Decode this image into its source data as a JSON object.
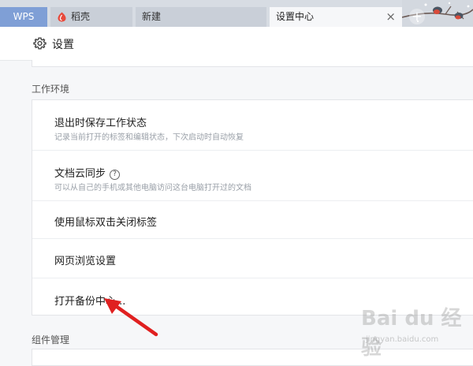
{
  "tabs": [
    {
      "label": "WPS"
    },
    {
      "label": "稻壳"
    },
    {
      "label": "新建"
    },
    {
      "label": "设置中心",
      "close": "×"
    }
  ],
  "add_tab": "+",
  "header": {
    "title": "设置"
  },
  "sections": {
    "work_env": "工作环境",
    "components": "组件管理"
  },
  "settings_rows": [
    {
      "title": "退出时保存工作状态",
      "desc": "记录当前打开的标签和编辑状态，下次启动时自动恢复"
    },
    {
      "title": "文档云同步",
      "desc": "可以从自己的手机或其他电脑访问这台电脑打开过的文档",
      "help": "?"
    },
    {
      "title": "使用鼠标双击关闭标签"
    },
    {
      "title": "网页浏览设置"
    },
    {
      "title": "打开备份中心..."
    }
  ],
  "watermark": {
    "brand": "Bai du 经验",
    "url": "jingyan.baidu.com"
  },
  "colors": {
    "wps_tab": "#7f9fd6",
    "arrow": "#e02020",
    "daoke": "#e84a3c"
  }
}
